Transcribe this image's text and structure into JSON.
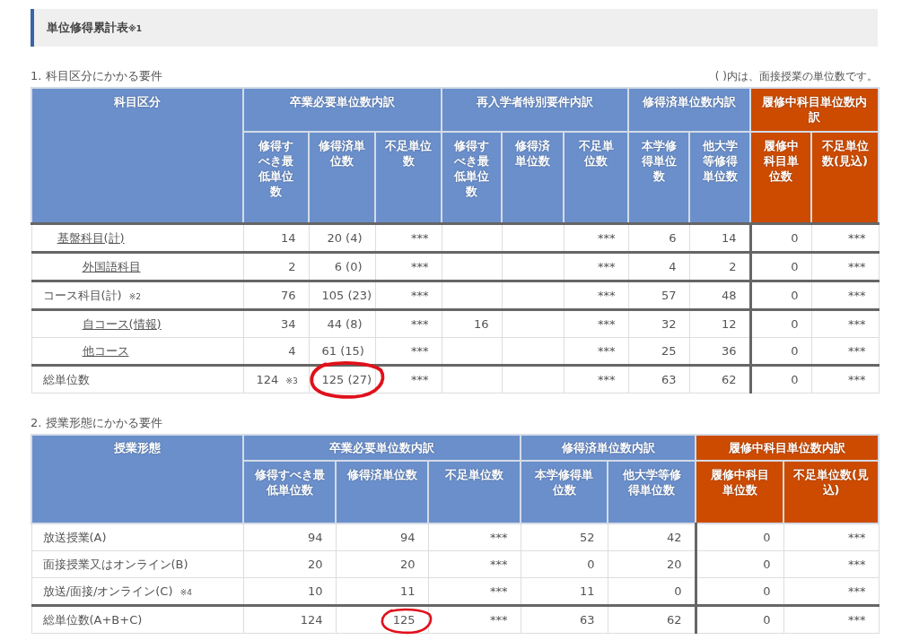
{
  "panel": {
    "title": "単位修得累計表",
    "note": "※1"
  },
  "sections": [
    {
      "heading": "1. 科目区分にかかる要件",
      "remark": "( )内は、面接授業の単位数です。",
      "table": {
        "label_heading": "科目区分",
        "groups": [
          {
            "label": "卒業必要単位数内訳",
            "color": "#6a8fcb",
            "columns": [
              "修得すべき最低単位数",
              "修得済単位数",
              "不足単位数"
            ]
          },
          {
            "label": "再入学者特別要件内訳",
            "color": "#6a8fcb",
            "columns": [
              "修得すべき最低単位数",
              "修得済単位数",
              "不足単位数"
            ]
          },
          {
            "label": "修得済単位数内訳",
            "color": "#6a8fcb",
            "columns": [
              "本学修得単位数",
              "他大学等修得単位数"
            ]
          },
          {
            "label": "履修中科目単位数内訳",
            "color": "#cc4b00",
            "columns": [
              "履修中科目単位数",
              "不足単位数(見込)"
            ]
          }
        ],
        "rows": [
          {
            "label": "基盤科目(計)",
            "link": true,
            "cells": [
              "14",
              "20 (4)",
              "***",
              null,
              null,
              "***",
              "6",
              "14",
              "0",
              "***"
            ],
            "children": [
              {
                "label": "外国語科目",
                "link": true,
                "cells": [
                  "2",
                  "6 (0)",
                  "***",
                  null,
                  null,
                  "***",
                  "4",
                  "2",
                  "0",
                  "***"
                ]
              }
            ]
          },
          {
            "label": "コース科目(計)",
            "note": "※2",
            "link": false,
            "cells": [
              "76",
              "105 (23)",
              "***",
              null,
              null,
              "***",
              "57",
              "48",
              "0",
              "***"
            ],
            "children": [
              {
                "label": "自コース(情報)",
                "link": true,
                "cells": [
                  "34",
                  "44 (8)",
                  "***",
                  "16",
                  null,
                  "***",
                  "32",
                  "12",
                  "0",
                  "***"
                ]
              },
              {
                "label": "他コース",
                "link": true,
                "cells": [
                  "4",
                  "61 (15)",
                  "***",
                  null,
                  null,
                  "***",
                  "25",
                  "36",
                  "0",
                  "***"
                ]
              }
            ]
          },
          {
            "label": "総単位数",
            "link": false,
            "cells": [
              {
                "text": "124",
                "note": "※3"
              },
              {
                "text": "125 (27)",
                "circled": true
              },
              "***",
              null,
              null,
              "***",
              "63",
              "62",
              "0",
              "***"
            ]
          }
        ]
      }
    },
    {
      "heading": "2. 授業形態にかかる要件",
      "table": {
        "label_heading": "授業形態",
        "groups": [
          {
            "label": "卒業必要単位数内訳",
            "color": "#6a8fcb",
            "columns": [
              "修得すべき最低単位数",
              "修得済単位数",
              "不足単位数"
            ]
          },
          {
            "label": "修得済単位数内訳",
            "color": "#6a8fcb",
            "columns": [
              "本学修得単位数",
              "他大学等修得単位数"
            ]
          },
          {
            "label": "履修中科目単位数内訳",
            "color": "#cc4b00",
            "columns": [
              "履修中科目単位数",
              "不足単位数(見込)"
            ]
          }
        ],
        "rows": [
          {
            "label": "放送授業(A)",
            "link": false,
            "cells": [
              "94",
              "94",
              "***",
              "52",
              "42",
              "0",
              "***"
            ]
          },
          {
            "label": "面接授業又はオンライン(B)",
            "link": false,
            "cells": [
              "20",
              "20",
              "***",
              "0",
              "20",
              "0",
              "***"
            ]
          },
          {
            "label": "放送/面接/オンライン(C)",
            "note": "※4",
            "link": false,
            "cells": [
              "10",
              "11",
              "***",
              "11",
              "0",
              "0",
              "***"
            ]
          },
          {
            "label": "総単位数(A+B+C)",
            "link": false,
            "cells": [
              "124",
              {
                "text": "125",
                "circled": true
              },
              "***",
              "63",
              "62",
              "0",
              "***"
            ]
          }
        ]
      }
    }
  ]
}
